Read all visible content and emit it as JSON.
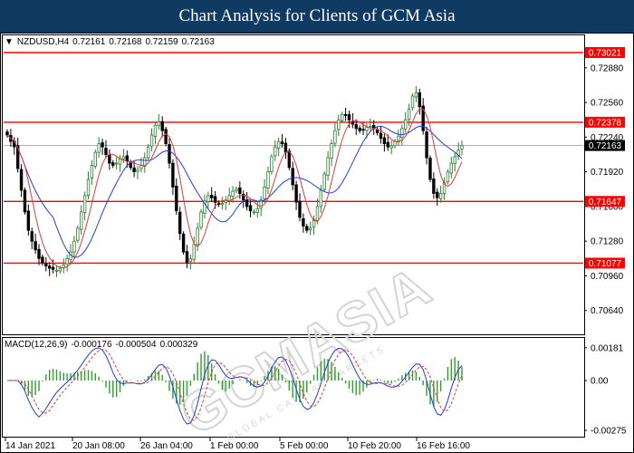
{
  "header": {
    "title": "Chart Analysis for Clients of GCM Asia"
  },
  "info": {
    "symbol": "NZDUSD,H4",
    "open": "0.72161",
    "high": "0.72168",
    "low": "0.72159",
    "close": "0.72163"
  },
  "macd_info": {
    "label": "MACD(12,26,9)",
    "v1": "-0.000176",
    "v2": "-0.000504",
    "v3": "0.000329"
  },
  "watermark": {
    "text": "GCMASIA",
    "subtext": "GLOBAL CAPITAL MARKETS"
  },
  "chart_data": [
    {
      "type": "candlestick",
      "symbol": "NZDUSD",
      "timeframe": "H4",
      "y_ticks": [
        "0.72880",
        "0.72560",
        "0.72240",
        "0.71920",
        "0.71600",
        "0.71280",
        "0.70960",
        "0.70640"
      ],
      "y_tick_values": [
        0.7288,
        0.7256,
        0.7224,
        0.7192,
        0.716,
        0.7128,
        0.7096,
        0.7064
      ],
      "ylim": [
        0.7042,
        0.7318
      ],
      "x_ticks": [
        "14 Jan 2021",
        "20 Jan 08:00",
        "26 Jan 04:00",
        "1 Feb 00:00",
        "5 Feb 00:00",
        "10 Feb 20:00",
        "16 Feb 16:00"
      ],
      "current_price": {
        "label": "0.72163",
        "value": 0.72163
      },
      "levels": [
        {
          "label": "0.73021",
          "value": 0.73021
        },
        {
          "label": "0.72378",
          "value": 0.72378
        },
        {
          "label": "0.71647",
          "value": 0.71647
        },
        {
          "label": "0.71077",
          "value": 0.71077
        }
      ],
      "colors": {
        "up": "#2e7d32",
        "down": "#000000",
        "ma_fast": "#e53935",
        "ma_slow": "#1e3fd6",
        "level": "#ff0000"
      },
      "closes": [
        0.7226,
        0.722,
        0.7215,
        0.7195,
        0.7175,
        0.7155,
        0.7138,
        0.7128,
        0.712,
        0.7112,
        0.7108,
        0.7105,
        0.7103,
        0.7102,
        0.7101,
        0.7103,
        0.7106,
        0.7112,
        0.7118,
        0.7128,
        0.714,
        0.7155,
        0.717,
        0.7185,
        0.7198,
        0.721,
        0.7218,
        0.7215,
        0.7208,
        0.72,
        0.7198,
        0.72,
        0.7204,
        0.7206,
        0.7202,
        0.7196,
        0.7192,
        0.7194,
        0.7198,
        0.7205,
        0.7215,
        0.7226,
        0.7235,
        0.7238,
        0.723,
        0.7218,
        0.72,
        0.7178,
        0.7156,
        0.7135,
        0.7118,
        0.7108,
        0.7112,
        0.7125,
        0.714,
        0.7155,
        0.7165,
        0.717,
        0.7168,
        0.7164,
        0.7162,
        0.7163,
        0.7166,
        0.717,
        0.7174,
        0.7176,
        0.7172,
        0.7166,
        0.716,
        0.7156,
        0.7155,
        0.7158,
        0.7166,
        0.7178,
        0.7192,
        0.7206,
        0.7215,
        0.722,
        0.7218,
        0.721,
        0.7196,
        0.718,
        0.7164,
        0.715,
        0.7142,
        0.7138,
        0.714,
        0.7148,
        0.716,
        0.7175,
        0.719,
        0.7205,
        0.7218,
        0.723,
        0.724,
        0.7245,
        0.7244,
        0.724,
        0.7236,
        0.7232,
        0.723,
        0.7231,
        0.7233,
        0.7234,
        0.7232,
        0.7228,
        0.7223,
        0.7218,
        0.7215,
        0.7216,
        0.722,
        0.7225,
        0.7232,
        0.724,
        0.725,
        0.7262,
        0.7265,
        0.7252,
        0.723,
        0.7205,
        0.7185,
        0.7172,
        0.7168,
        0.7172,
        0.7182,
        0.7192,
        0.72,
        0.7206,
        0.7212,
        0.7216
      ]
    },
    {
      "type": "histogram+line",
      "name": "MACD(12,26,9)",
      "y_ticks": [
        "0.00181",
        "0.00",
        "-0.00275"
      ],
      "y_tick_values": [
        0.00181,
        0.0,
        -0.00275
      ],
      "ylim": [
        -0.0031,
        0.0023
      ],
      "x_ticks": [
        "14 Jan 2021",
        "20 Jan 08:00",
        "26 Jan 04:00",
        "1 Feb 00:00",
        "5 Feb 00:00",
        "10 Feb 20:00",
        "16 Feb 16:00"
      ],
      "colors": {
        "histogram": "#2e9e2e",
        "macd": "#1e3fd6",
        "signal": "#e53935"
      }
    }
  ]
}
